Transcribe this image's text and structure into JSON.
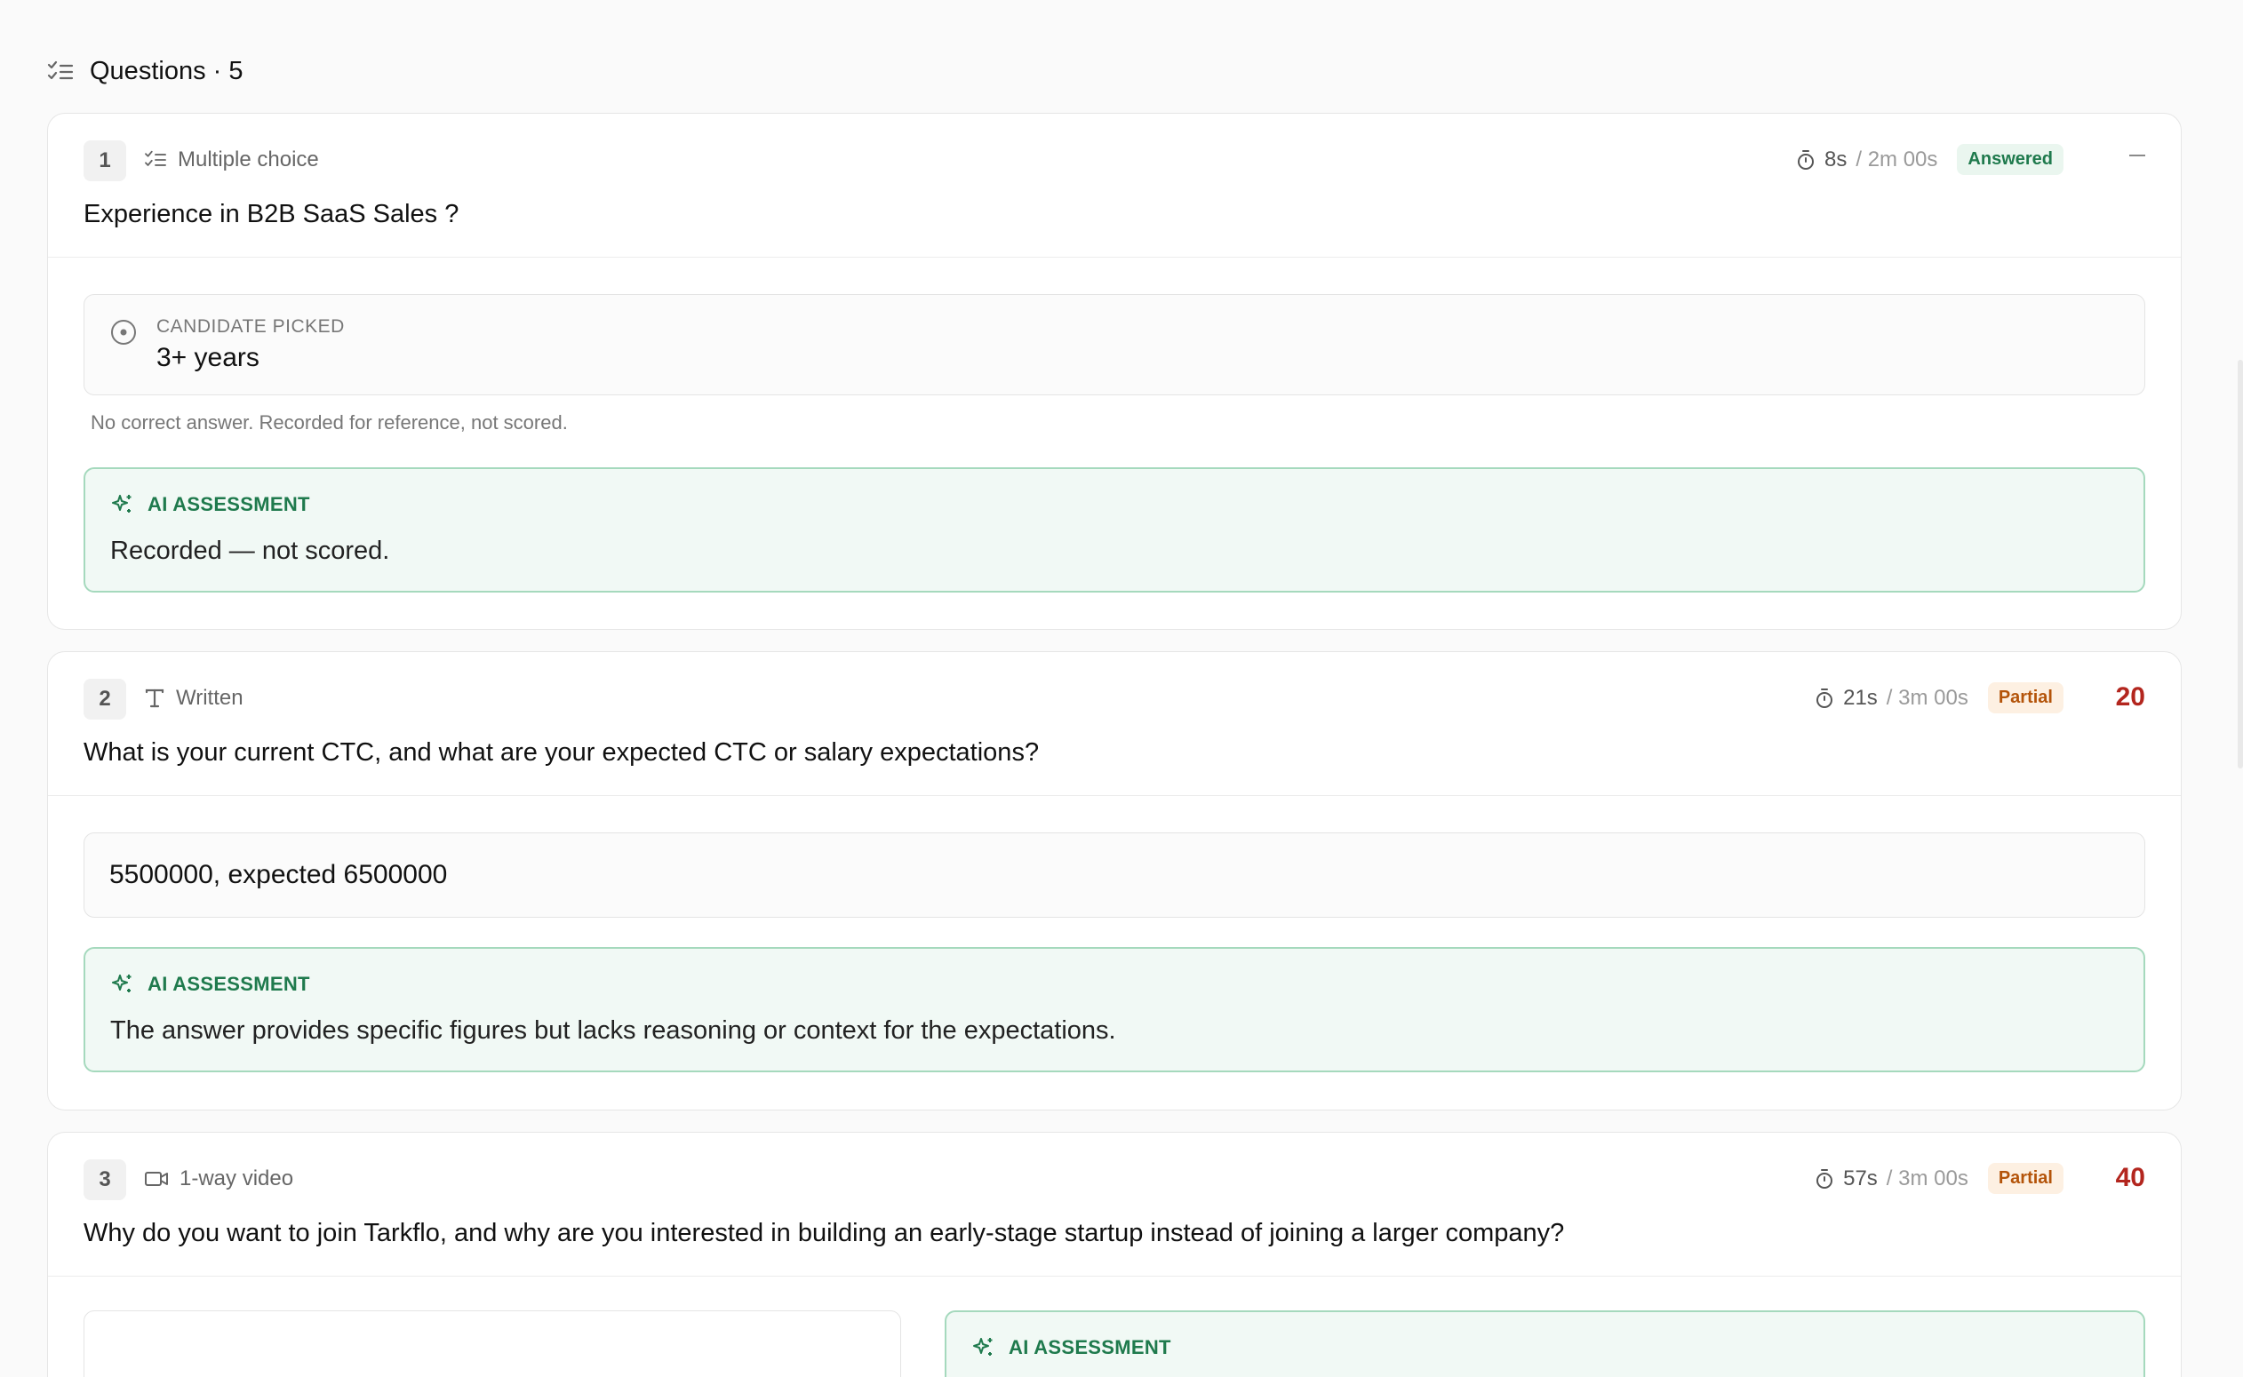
{
  "section": {
    "title": "Questions · 5"
  },
  "questions": [
    {
      "number": "1",
      "type_label": "Multiple choice",
      "text": "Experience in B2B SaaS Sales ?",
      "time": "8s",
      "limit": "/ 2m 00s",
      "status": "Answered",
      "picked_label": "CANDIDATE PICKED",
      "picked_value": "3+ years",
      "note": "No correct answer. Recorded for reference, not scored.",
      "ai_label": "AI ASSESSMENT",
      "ai_text": "Recorded — not scored."
    },
    {
      "number": "2",
      "type_label": "Written",
      "text": "What is your current CTC, and what are your expected CTC or salary expectations?",
      "time": "21s",
      "limit": "/ 3m 00s",
      "status": "Partial",
      "score": "20",
      "answer": "5500000, expected 6500000",
      "ai_label": "AI ASSESSMENT",
      "ai_text": "The answer provides specific figures but lacks reasoning or context for the expectations."
    },
    {
      "number": "3",
      "type_label": "1-way video",
      "text": "Why do you want to join Tarkflo, and why are you interested in building an early-stage startup instead of joining a larger company?",
      "time": "57s",
      "limit": "/ 3m 00s",
      "status": "Partial",
      "score": "40",
      "ai_label": "AI ASSESSMENT"
    }
  ],
  "colors": {
    "accent_green": "#1f7a4d",
    "ai_bg": "#f1f9f5",
    "ai_border": "#a5d9bd",
    "partial_text": "#b4540a",
    "partial_bg": "#fdf0e2",
    "score_red": "#b3261e"
  },
  "icons": {
    "section": "checklist-icon",
    "multiple_choice": "checklist-icon",
    "written": "text-type-icon",
    "video": "video-camera-icon",
    "timer": "stopwatch-icon",
    "picked": "radio-selected-icon",
    "ai": "sparkle-icon",
    "collapse": "minus-icon"
  }
}
